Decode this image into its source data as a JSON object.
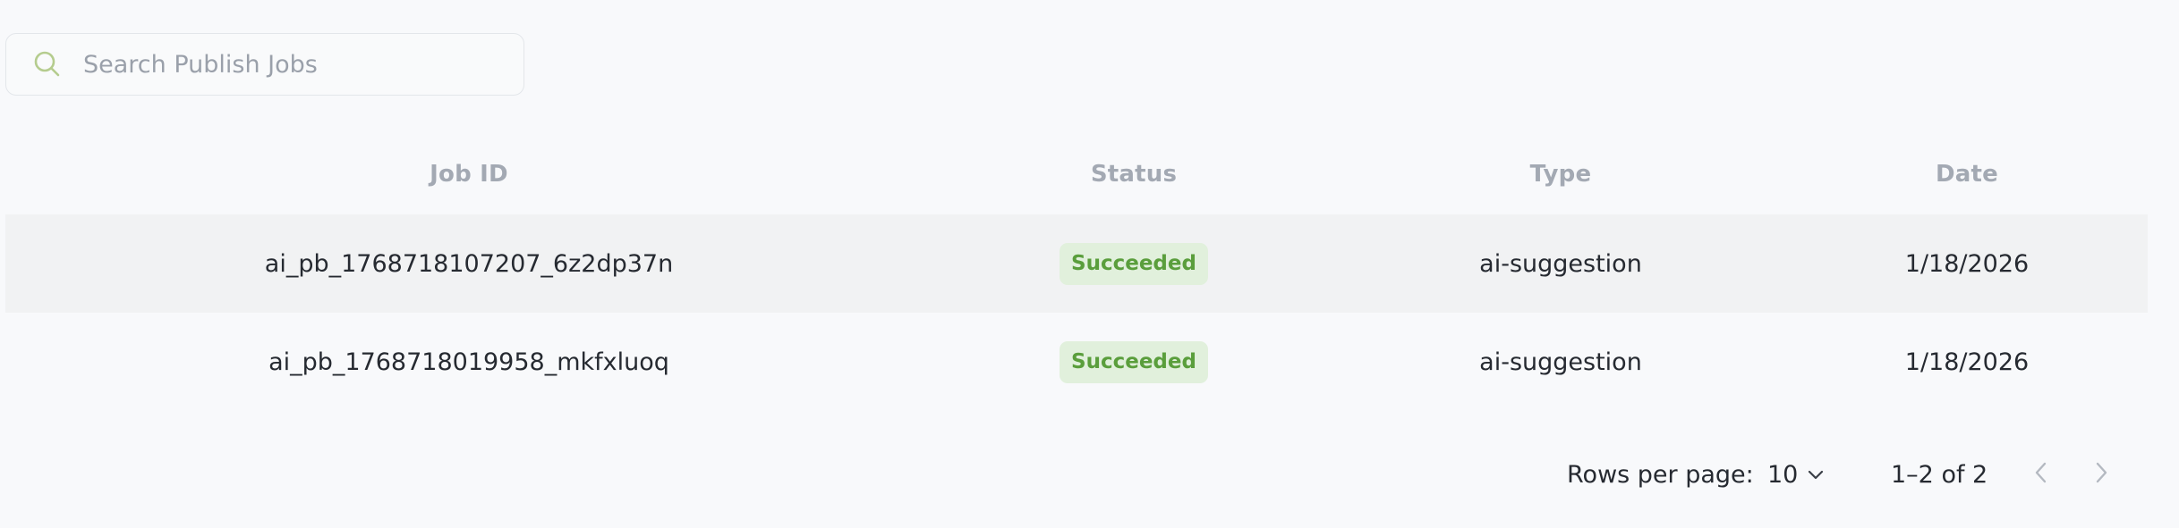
{
  "search": {
    "placeholder": "Search Publish Jobs",
    "value": "",
    "icon": "search-icon"
  },
  "table": {
    "columns": {
      "job_id": "Job ID",
      "status": "Status",
      "type": "Type",
      "date": "Date"
    },
    "rows": [
      {
        "job_id": "ai_pb_1768718107207_6z2dp37n",
        "status": "Succeeded",
        "type": "ai-suggestion",
        "date": "1/18/2026"
      },
      {
        "job_id": "ai_pb_1768718019958_mkfxluoq",
        "status": "Succeeded",
        "type": "ai-suggestion",
        "date": "1/18/2026"
      }
    ]
  },
  "pagination": {
    "rows_per_page_label": "Rows per page:",
    "rows_per_page_value": "10",
    "range_text": "1–2 of 2",
    "prev_icon": "chevron-left-icon",
    "next_icon": "chevron-right-icon"
  },
  "colors": {
    "background": "#f8f9fb",
    "row_highlight": "#f1f2f3",
    "badge_bg": "#e1f0dc",
    "badge_text": "#5a9e3c",
    "header_text": "#a3a9b3",
    "search_icon": "#b5cc8e"
  }
}
